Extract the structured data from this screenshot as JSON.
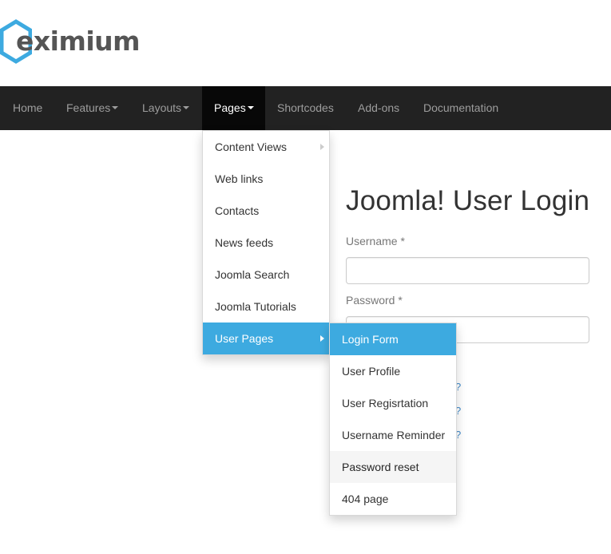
{
  "logo": {
    "text": "eximium",
    "accent_color": "#3daae0"
  },
  "nav": {
    "items": [
      {
        "label": "Home"
      },
      {
        "label": "Features"
      },
      {
        "label": "Layouts"
      },
      {
        "label": "Pages"
      },
      {
        "label": "Shortcodes"
      },
      {
        "label": "Add-ons"
      },
      {
        "label": "Documentation"
      }
    ]
  },
  "pages_menu": {
    "items": [
      {
        "label": "Content Views"
      },
      {
        "label": "Web links"
      },
      {
        "label": "Contacts"
      },
      {
        "label": "News feeds"
      },
      {
        "label": "Joomla Search"
      },
      {
        "label": "Joomla Tutorials"
      },
      {
        "label": "User Pages"
      }
    ]
  },
  "user_pages_menu": {
    "items": [
      {
        "label": "Login Form"
      },
      {
        "label": "User Profile"
      },
      {
        "label": "User Regisrtation"
      },
      {
        "label": "Username Reminder"
      },
      {
        "label": "Password reset"
      },
      {
        "label": "404 page"
      }
    ]
  },
  "login": {
    "title": "Joomla! User Login",
    "username_label": "Username *",
    "password_label": "Password *",
    "link_fragments": [
      "?",
      "?",
      "?"
    ]
  },
  "colors": {
    "navbar_bg": "#222222",
    "active_bg": "#080808",
    "highlight": "#3daae0",
    "link": "#428bca"
  }
}
